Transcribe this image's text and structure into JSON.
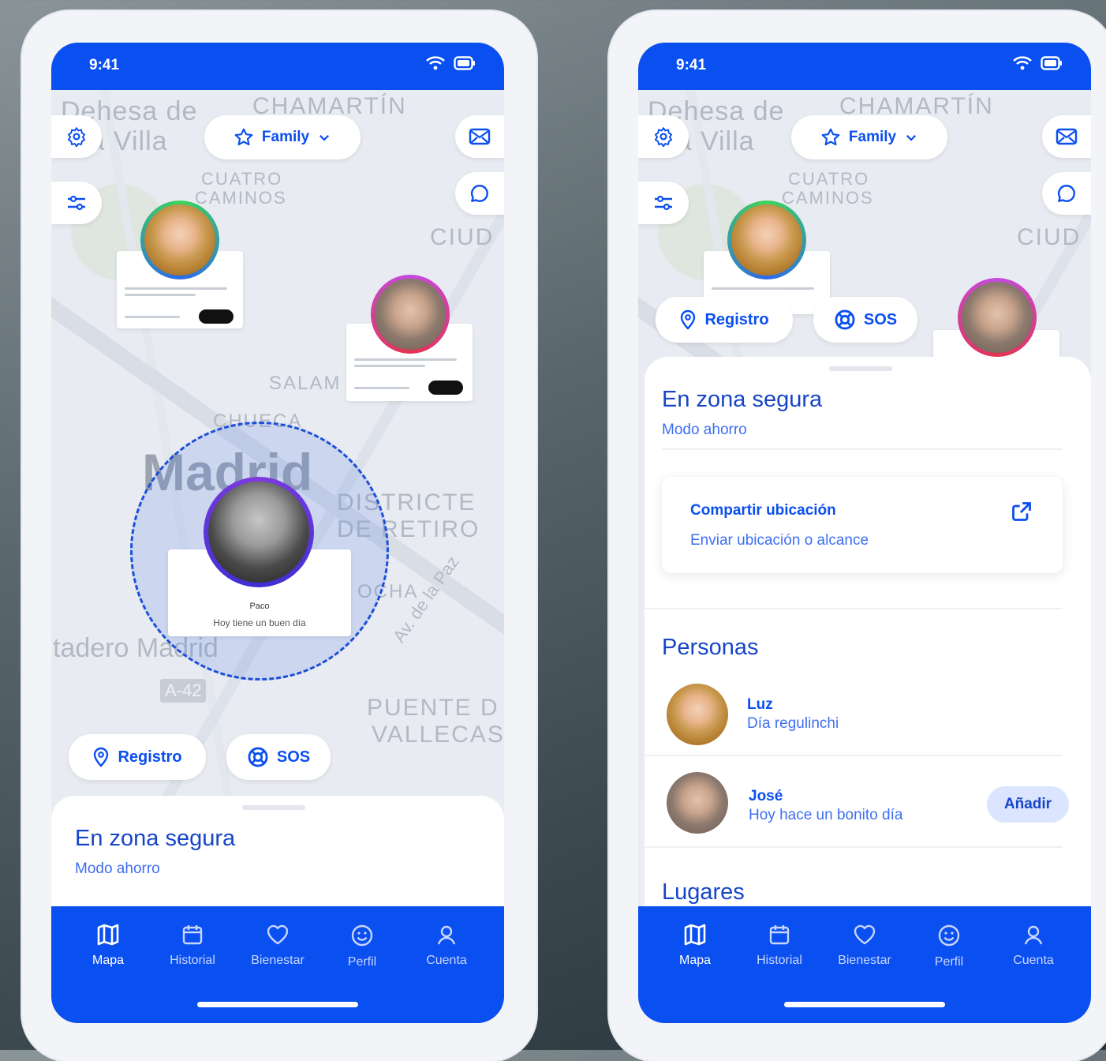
{
  "status": {
    "time": "9:41"
  },
  "header": {
    "family_label": "Family"
  },
  "map_labels": {
    "dehesa": "Dehesa de",
    "villa": "la Villa",
    "chamartin": "CHAMARTÍN",
    "cuatro": "CUATRO",
    "caminos": "CAMINOS",
    "ciudad": "CIUD",
    "salamanca": "SALAM",
    "chueca": "CHUECA",
    "madrid": "Madrid",
    "districte": "DISTRICTE",
    "de_retiro": "DE RETIRO",
    "ocha": "OCHA",
    "av_paz": "Av. de la Paz",
    "matadero": "tadero Madrid",
    "a42": "A-42",
    "puente": "PUENTE D",
    "vallecas": "VALLECAS"
  },
  "markers": {
    "paco_name": "Paco",
    "paco_status": "Hoy tiene un buen día"
  },
  "actions": {
    "registro": "Registro",
    "sos": "SOS"
  },
  "sheet": {
    "title": "En zona segura",
    "subtitle": "Modo ahorro",
    "share_title": "Compartir ubicación",
    "share_sub": "Enviar ubicación o alcance",
    "people_header": "Personas",
    "places_header": "Lugares",
    "people": [
      {
        "name": "Luz",
        "status": "Día regulinchi"
      },
      {
        "name": "José",
        "status": "Hoy hace un bonito día",
        "action": "Añadir"
      }
    ]
  },
  "tabs": [
    {
      "label": "Mapa",
      "icon": "map-icon"
    },
    {
      "label": "Historial",
      "icon": "calendar-icon"
    },
    {
      "label": "Bienestar",
      "icon": "heart-icon"
    },
    {
      "label": "Perfil",
      "icon": "smile-icon"
    },
    {
      "label": "Cuenta",
      "icon": "user-icon"
    }
  ],
  "colors": {
    "primary": "#0a4ff0",
    "sheet_title": "#1646c7",
    "add_button_bg": "#dbe5ff"
  }
}
